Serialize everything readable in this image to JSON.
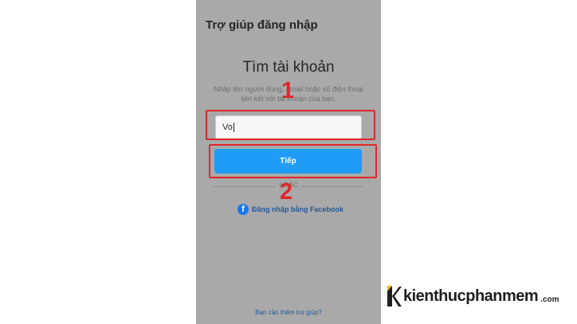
{
  "header": {
    "title": "Trợ giúp đăng nhập"
  },
  "main": {
    "title": "Tìm tài khoản",
    "description": "Nhập tên người dùng, email hoặc số điện thoại liên kết với tài khoản của bạn.",
    "input_value": "Vo",
    "next_button": "Tiếp",
    "divider": "HOẶC",
    "facebook_link": "Đăng nhập bằng Facebook",
    "help_link": "Bạn cần thêm trợ giúp?"
  },
  "annotations": {
    "step1": "1",
    "step2": "2",
    "highlight_color": "#e0262a"
  },
  "icons": {
    "facebook": "facebook-icon",
    "facebook_glyph": "f"
  },
  "watermark": {
    "brand": "kienthucphanmem",
    "domain": ".com"
  },
  "colors": {
    "button": "#1f9cf5",
    "link": "#235a9c",
    "overlay": "#a9a9a9"
  }
}
